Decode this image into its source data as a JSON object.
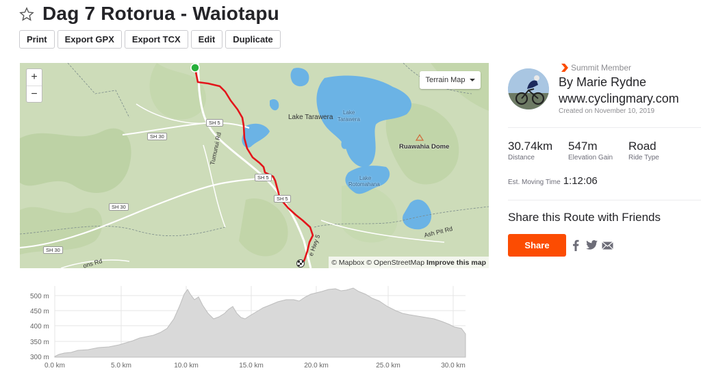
{
  "header": {
    "title": "Dag 7 Rotorua - Waiotapu",
    "actions": [
      "Print",
      "Export GPX",
      "Export TCX",
      "Edit",
      "Duplicate"
    ]
  },
  "map": {
    "zoom_in": "+",
    "zoom_out": "−",
    "terrain_button": "Terrain Map",
    "attribution": {
      "mapbox": "© Mapbox",
      "osm": "© OpenStreetMap",
      "improve": "Improve this map"
    },
    "labels": {
      "lake_tarawera": "Lake Tarawera",
      "lake_tarawera_inner_1": "Lake",
      "lake_tarawera_inner_2": "Tarawera",
      "ruawahia": "Ruawahia Dome",
      "rotomahana_1": "Lake",
      "rotomahana_2": "Rotomahana",
      "tumunui": "Tumunui Rd",
      "ashpit": "Ash Pit Rd",
      "ons_rd": "ons Rd",
      "hwy": "e Hwy 5"
    },
    "shields": [
      "SH 5",
      "SH 30",
      "SH 30",
      "SH 30",
      "SH 5",
      "SH 5"
    ],
    "colors": {
      "route": "#e3151b",
      "start": "#27b03a",
      "water": "#6bb3e5",
      "land": "#c9dbb4"
    }
  },
  "elevation": {
    "y_ticks": [
      "500 m",
      "450 m",
      "400 m",
      "350 m",
      "300 m"
    ],
    "x_ticks": [
      "0.0 km",
      "5.0 km",
      "10.0 km",
      "15.0 km",
      "20.0 km",
      "25.0 km",
      "30.0 km"
    ]
  },
  "athlete": {
    "badge": "Summit Member",
    "name": "By Marie Rydne",
    "website": "www.cyclingmary.com",
    "created": "Created on November 10, 2019"
  },
  "stats": {
    "distance_value": "30.74km",
    "distance_label": "Distance",
    "elevation_value": "547m",
    "elevation_label": "Elevation Gain",
    "type_value": "Road",
    "type_label": "Ride Type",
    "moving_label": "Est. Moving Time",
    "moving_value": "1:12:06"
  },
  "share": {
    "title": "Share this Route with Friends",
    "button": "Share",
    "icons": [
      "facebook-icon",
      "twitter-icon",
      "email-icon"
    ]
  }
}
